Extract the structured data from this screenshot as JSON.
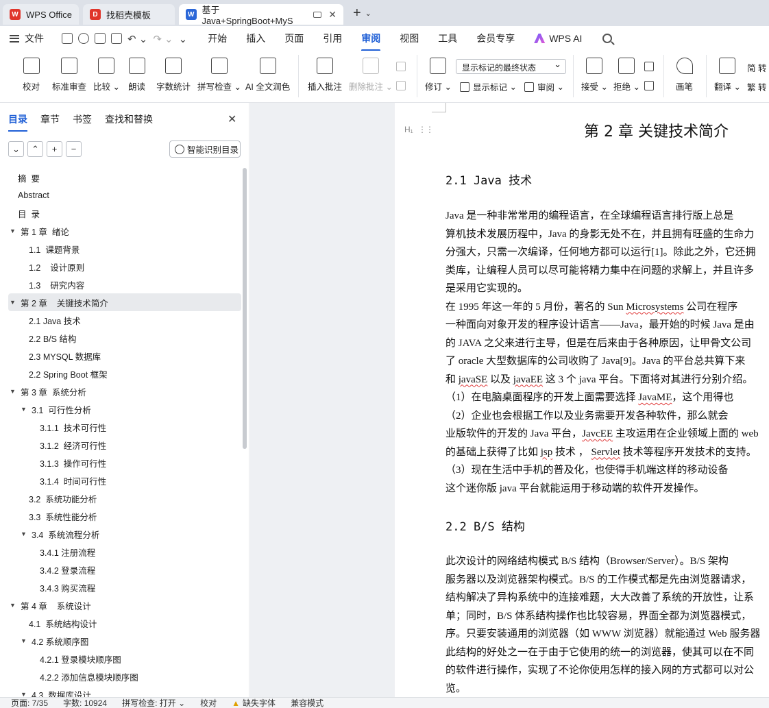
{
  "tabs": [
    {
      "label": "WPS Office",
      "color": "#e0352b",
      "logo": "W",
      "icon": "wps-logo-icon"
    },
    {
      "label": "找稻壳模板",
      "color": "#e0352b",
      "logo": "D",
      "icon": "docer-logo-icon"
    },
    {
      "label": "基于Java+SpringBoot+MyS",
      "color": "#2b67d8",
      "logo": "W",
      "icon": "writer-logo-icon"
    }
  ],
  "menu": {
    "file": "文件",
    "items": [
      "开始",
      "插入",
      "页面",
      "引用",
      "审阅",
      "视图",
      "工具",
      "会员专享"
    ],
    "active": "审阅",
    "wps_ai": "WPS AI"
  },
  "ribbon": {
    "proofread": "校对",
    "std_review": "标准审查",
    "compare": "比较",
    "read_aloud": "朗读",
    "word_count": "字数统计",
    "spell_check": "拼写检查",
    "ai_polish": "AI 全文润色",
    "insert_comment": "插入批注",
    "delete_comment": "删除批注",
    "track_changes": "修订",
    "show_markup_select": "显示标记的最终状态",
    "show_markup": "显示标记",
    "review_pane": "审阅",
    "accept": "接受",
    "reject": "拒绝",
    "pen": "画笔",
    "translate": "翻译",
    "to_simplified": "简 转",
    "to_traditional": "繁 转"
  },
  "nav": {
    "tabs": [
      "目录",
      "章节",
      "书签",
      "查找和替换"
    ],
    "active": "目录",
    "smart_button": "智能识别目录",
    "toc": [
      {
        "label": "摘  要",
        "level": 1,
        "arrow": ""
      },
      {
        "label": "Abstract",
        "level": 1,
        "arrow": ""
      },
      {
        "label": "目  录",
        "level": 1,
        "arrow": ""
      },
      {
        "label": "第 1 章  绪论",
        "level": 1,
        "arrow": "▼"
      },
      {
        "label": "1.1  课题背景",
        "level": 2,
        "arrow": ""
      },
      {
        "label": "1.2    设计原则",
        "level": 2,
        "arrow": ""
      },
      {
        "label": "1.3    研究内容",
        "level": 2,
        "arrow": ""
      },
      {
        "label": "第 2 章    关键技术简介",
        "level": 1,
        "arrow": "▼",
        "selected": true
      },
      {
        "label": "2.1 Java 技术",
        "level": 2,
        "arrow": ""
      },
      {
        "label": "2.2 B/S 结构",
        "level": 2,
        "arrow": ""
      },
      {
        "label": "2.3 MYSQL 数据库",
        "level": 2,
        "arrow": ""
      },
      {
        "label": "2.2 Spring Boot 框架",
        "level": 2,
        "arrow": ""
      },
      {
        "label": "第 3 章  系统分析",
        "level": 1,
        "arrow": "▼"
      },
      {
        "label": "3.1  可行性分析",
        "level": 2,
        "arrow": "▼"
      },
      {
        "label": "3.1.1  技术可行性",
        "level": 3,
        "arrow": ""
      },
      {
        "label": "3.1.2  经济可行性",
        "level": 3,
        "arrow": ""
      },
      {
        "label": "3.1.3  操作可行性",
        "level": 3,
        "arrow": ""
      },
      {
        "label": "3.1.4  时间可行性",
        "level": 3,
        "arrow": ""
      },
      {
        "label": "3.2  系统功能分析",
        "level": 2,
        "arrow": ""
      },
      {
        "label": "3.3  系统性能分析",
        "level": 2,
        "arrow": ""
      },
      {
        "label": "3.4  系统流程分析",
        "level": 2,
        "arrow": "▼"
      },
      {
        "label": "3.4.1 注册流程",
        "level": 3,
        "arrow": ""
      },
      {
        "label": "3.4.2 登录流程",
        "level": 3,
        "arrow": ""
      },
      {
        "label": "3.4.3 购买流程",
        "level": 3,
        "arrow": ""
      },
      {
        "label": "第 4 章    系统设计",
        "level": 1,
        "arrow": "▼"
      },
      {
        "label": "4.1  系统结构设计",
        "level": 2,
        "arrow": ""
      },
      {
        "label": "4.2 系统顺序图",
        "level": 2,
        "arrow": "▼"
      },
      {
        "label": "4.2.1 登录模块顺序图",
        "level": 3,
        "arrow": ""
      },
      {
        "label": "4.2.2 添加信息模块顺序图",
        "level": 3,
        "arrow": ""
      },
      {
        "label": "4.3  数据库设计",
        "level": 2,
        "arrow": "▼"
      }
    ]
  },
  "doc": {
    "chapter": "第 2 章    关键技术简介",
    "h21": "2.1  Java 技术",
    "p1": [
      "        Java 是一种非常常用的编程语言，在全球编程语言排行版上总是",
      "算机技术发展历程中，Java 的身影无处不在，并且拥有旺盛的生命力",
      "分强大，只需一次编译，任何地方都可以运行[1]。除此之外，它还拥",
      "类库，让编程人员可以尽可能将精力集中在问题的求解上，并且许多",
      "是采用它实现的。"
    ],
    "p2_l1a": "        在 1995 年这一年的 5 月份，著名的 Sun ",
    "p2_l1b": "Microsystems",
    "p2_l1c": " 公司在程序",
    "p2_l2": "一种面向对象开发的程序设计语言——Java，最开始的时候 Java 是由",
    "p2_l3": "的 JAVA 之父来进行主导，但是在后来由于各种原因，让甲骨文公司",
    "p2_l4": "了 oracle 大型数据库的公司收购了 Java[9]。Java 的平台总共算下来",
    "p2_l5a": "和 ",
    "p2_l5b": "javaSE",
    "p2_l5c": " 以及 ",
    "p2_l5d": "javaEE",
    "p2_l5e": " 这 3 个 java 平台。下面将对其进行分别介绍。",
    "p3a": "        （1）在电脑桌面程序的开发上面需要选择 ",
    "p3b": "JavaME",
    "p3c": "，这个用得也",
    "p4_l1": "        （2）企业也会根据工作以及业务需要开发各种软件，那么就会",
    "p4_l2a": "业版软件的开发的 Java 平台，",
    "p4_l2b": "JavcEE",
    "p4_l2c": " 主攻运用在企业领域上面的 web",
    "p4_l3a": "的基础上获得了比如 ",
    "p4_l3b": "jsp",
    "p4_l3c": " 技术 ， ",
    "p4_l3d": "Servlet",
    "p4_l3e": " 技术等程序开发技术的支持。",
    "p5_l1": "        （3）现在生活中手机的普及化，也使得手机端这样的移动设备",
    "p5_l2": "这个迷你版 java 平台就能运用于移动端的软件开发操作。",
    "h22": "2.2  B/S 结构",
    "p6": [
      "        此次设计的网络结构模式 B/S 结构（Browser/Server）。B/S 架构",
      "服务器以及浏览器架构模式。B/S 的工作模式都是先由浏览器请求，",
      "结构解决了异构系统中的连接难题，大大改善了系统的开放性，让系",
      "单；同时，B/S 体系结构操作也比较容易，界面全都为浏览器模式，",
      "序。只要安装通用的浏览器（如 WWW 浏览器）就能通过 Web 服务器",
      "此结构的好处之一在于由于它使用的统一的浏览器，使其可以在不同",
      "的软件进行操作，实现了不论你使用怎样的接入网的方式都可以对公",
      "览。"
    ]
  },
  "status": {
    "page": "页面: 7/35",
    "words": "字数: 10924",
    "spell": "拼写检查: 打开 ⌄",
    "proof": "校对",
    "missing_font": "缺失字体",
    "compat": "兼容模式"
  }
}
